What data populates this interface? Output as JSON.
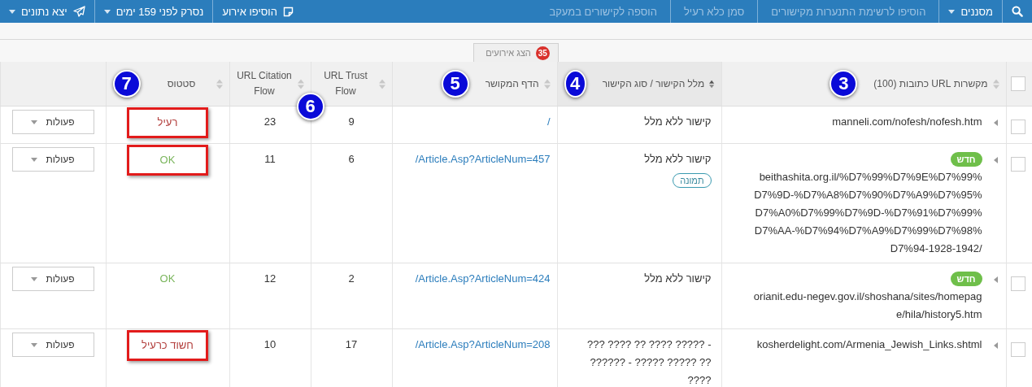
{
  "toolbar": {
    "right_items": [
      {
        "kind": "search",
        "disabled": false
      },
      {
        "kind": "dropdown",
        "label": "מסננים",
        "disabled": false
      },
      {
        "kind": "button",
        "label": "הוסיפו לרשימת התנערות מקישורים",
        "disabled": true
      },
      {
        "kind": "button",
        "label": "סמן כלא רעיל",
        "disabled": true
      },
      {
        "kind": "button",
        "label": "הוספה לקישורים במעקב",
        "disabled": true
      }
    ],
    "left_items": [
      {
        "kind": "note",
        "label": "הוסיפו אירוע",
        "disabled": false
      },
      {
        "kind": "dropdown",
        "label": "נסרק לפני 159 ימים",
        "disabled": false
      },
      {
        "kind": "send",
        "label": "יצא נתונים",
        "disabled": false
      }
    ]
  },
  "events_button": {
    "label": "הצג אירועים",
    "count": "35"
  },
  "table": {
    "select_all": {
      "checked": false
    },
    "columns": [
      {
        "label": "מקשרות URL כתובות (100)",
        "sorted": false,
        "marker": "3"
      },
      {
        "label": "מלל הקישור / סוג הקישור",
        "sorted": true,
        "marker": "4"
      },
      {
        "label": "הדף המקושר",
        "sorted": false,
        "marker": "5"
      },
      {
        "label": "URL Trust Flow",
        "sorted": false,
        "marker": "6"
      },
      {
        "label": "URL Citation Flow",
        "sorted": false
      },
      {
        "label": "סטטוס",
        "sorted": false,
        "marker": "7"
      }
    ],
    "rows": [
      {
        "checked": false,
        "is_new": false,
        "url": "manneli.com/nofesh/nofesh.htm",
        "anchor": "קישור ללא מלל",
        "tags": [],
        "target": "/",
        "trust_flow": "9",
        "citation_flow": "23",
        "status": "רעיל",
        "color": "#b3403e",
        "marked": true,
        "action": "פעולות"
      },
      {
        "checked": false,
        "is_new": true,
        "new_label": "חדש",
        "url": "beithashita.org.il/%D7%99%D7%9E%D7%99%D7%9D-%D7%A8%D7%90%D7%A9%D7%95%D7%A0%D7%99%D7%9D-%D7%91%D7%99%D7%AA-%D7%94%D7%A9%D7%99%D7%98%D7%94-1928-1942/",
        "anchor": "קישור ללא מלל",
        "tags": [
          "תמונה"
        ],
        "target": "/Article.Asp?ArticleNum=457",
        "trust_flow": "6",
        "citation_flow": "11",
        "status": "OK",
        "color": "#7ab55c",
        "marked": true,
        "action": "פעולות"
      },
      {
        "checked": false,
        "is_new": true,
        "new_label": "חדש",
        "url": "orianit.edu-negev.gov.il/shoshana/sites/homepage/hila/history5.htm",
        "anchor": "קישור ללא מלל",
        "tags": [],
        "target": "/Article.Asp?ArticleNum=424",
        "trust_flow": "2",
        "citation_flow": "12",
        "status": "OK",
        "color": "#7ab55c",
        "marked": false,
        "action": "פעולות"
      },
      {
        "checked": false,
        "is_new": false,
        "url": "kosherdelight.com/Armenia_Jewish_Links.shtml",
        "anchor": "??? ???? ?? ???? ????? - ?????? - ????? ????? ?? ????",
        "tags": [],
        "target": "/Article.Asp?ArticleNum=208",
        "trust_flow": "17",
        "citation_flow": "10",
        "status": "חשוד כרעיל",
        "color": "#b3403e",
        "marked": true,
        "action": "פעולות"
      }
    ]
  }
}
